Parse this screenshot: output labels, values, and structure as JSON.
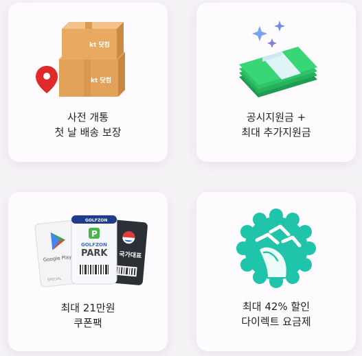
{
  "cards": [
    {
      "line1": "사전 개통",
      "line2": "첫 날 배송 보장",
      "box_brand": "kt 닷컴",
      "icons": [
        "shipping-boxes-icon",
        "location-pin-icon"
      ]
    },
    {
      "line1": "공시지원금 +",
      "line2": "최대 추가지원금",
      "icons": [
        "money-stack-icon",
        "sparkle-icon"
      ]
    },
    {
      "line1": "최대 21만원",
      "line2": "쿠폰팩",
      "coupon_left": "Google Play",
      "coupon_left_sub": "SPECIAL",
      "coupon_center_top": "GOLFZON",
      "coupon_center_mid": "GOLFZON",
      "coupon_center_main": "PARK",
      "coupon_right": "국가대표",
      "icons": [
        "coupon-tickets-icon"
      ]
    },
    {
      "line1": "최대 42% 할인",
      "line2": "다이렉트 요금제",
      "icons": [
        "wave-hand-badge-icon"
      ]
    }
  ],
  "colors": {
    "box": "#e3a25a",
    "pin": "#e02a2a",
    "money": "#2fc46a",
    "badge": "#1fc4aa",
    "sparkle": "#6a8cf0"
  }
}
